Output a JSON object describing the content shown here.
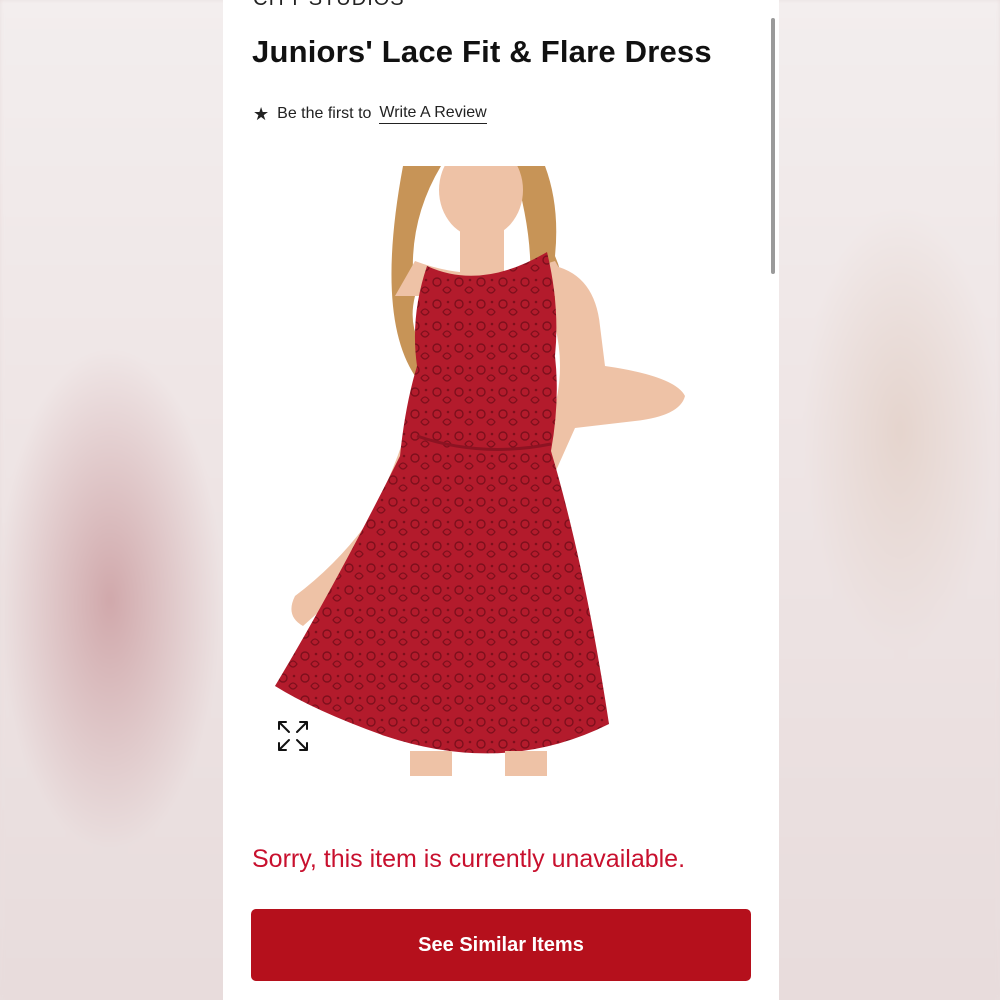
{
  "product": {
    "brand": "CITY STUDIOS",
    "title": "Juniors' Lace Fit & Flare Dress",
    "review_prefix": "Be the first to",
    "review_link": "Write A Review",
    "image_icon": "star-icon",
    "expand_icon": "expand-icon"
  },
  "availability": {
    "message": "Sorry, this item is currently unavailable."
  },
  "actions": {
    "see_similar_label": "See Similar Items"
  },
  "colors": {
    "brand_red": "#b5101c",
    "alert_red": "#c8102e",
    "dress_red": "#b31b2c"
  }
}
